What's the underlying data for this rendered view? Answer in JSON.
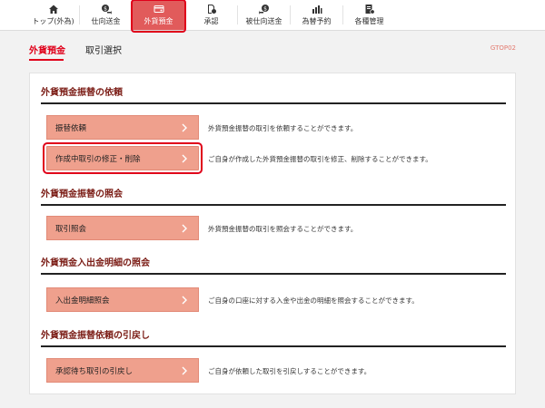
{
  "nav": {
    "items": [
      {
        "label": "トップ(外為)",
        "icon": "home-icon"
      },
      {
        "label": "仕向送金",
        "icon": "coin-send-icon"
      },
      {
        "label": "外貨預金",
        "icon": "card-icon",
        "active": true
      },
      {
        "label": "承認",
        "icon": "approve-icon"
      },
      {
        "label": "被仕向送金",
        "icon": "coin-receive-icon"
      },
      {
        "label": "為替予約",
        "icon": "chart-icon"
      },
      {
        "label": "各種管理",
        "icon": "settings-icon"
      }
    ]
  },
  "header": {
    "title": "外貨預金",
    "subtitle": "取引選択",
    "screen_code": "GTOP02"
  },
  "sections": [
    {
      "title": "外貨預金振替の依頼",
      "actions": [
        {
          "label": "振替依頼",
          "description": "外貨預金振替の取引を依頼することができます。"
        },
        {
          "label": "作成中取引の修正・削除",
          "description": "ご自身が作成した外貨預金振替の取引を修正、削除することができます。"
        }
      ]
    },
    {
      "title": "外貨預金振替の照会",
      "actions": [
        {
          "label": "取引照会",
          "description": "外貨預金振替の取引を照会することができます。"
        }
      ]
    },
    {
      "title": "外貨預金入出金明細の照会",
      "actions": [
        {
          "label": "入出金明細照会",
          "description": "ご自身の口座に対する入金や出金の明細を照会することができます。"
        }
      ]
    },
    {
      "title": "外貨預金振替依頼の引戻し",
      "actions": [
        {
          "label": "承認待ち取引の引戻し",
          "description": "ご自身が依頼した取引を引戻しすることができます。"
        }
      ]
    }
  ],
  "colors": {
    "accent": "#e0001a",
    "button": "#efa08d",
    "section_title": "#7a1b14"
  }
}
